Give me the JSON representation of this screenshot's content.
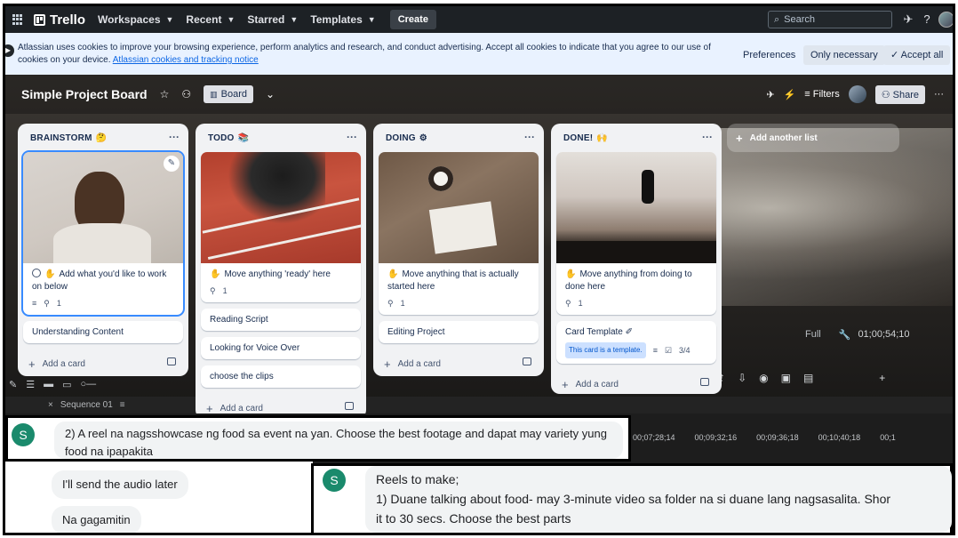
{
  "topnav": {
    "logo": "Trello",
    "menus": [
      "Workspaces",
      "Recent",
      "Starred",
      "Templates"
    ],
    "create_label": "Create",
    "search_placeholder": "Search"
  },
  "cookie": {
    "text": "Atlassian uses cookies to improve your browsing experience, perform analytics and research, and conduct advertising. Accept all cookies to indicate that you agree to our use of cookies on your device.",
    "link": "Atlassian cookies and tracking notice",
    "preferences": "Preferences",
    "only_necessary": "Only necessary",
    "accept_all": "Accept all"
  },
  "board": {
    "title": "Simple Project Board",
    "view_label": "Board",
    "filters_label": "Filters",
    "share_label": "Share",
    "add_list_label": "Add another list"
  },
  "lists": [
    {
      "name": "BRAINSTORM",
      "emoji": "🤔",
      "cover_card": {
        "title": "Add what you'd like to work on below",
        "attachments": "1"
      },
      "cards": [
        "Understanding Content"
      ],
      "add_label": "Add a card"
    },
    {
      "name": "TODO",
      "emoji": "📚",
      "cover_card": {
        "title": "Move anything 'ready' here",
        "attachments": "1"
      },
      "cards": [
        "Reading Script",
        "Looking for Voice Over",
        "choose the clips"
      ],
      "add_label": "Add a card"
    },
    {
      "name": "DOING",
      "emoji": "⚙",
      "cover_card": {
        "title": "Move anything that is actually started here",
        "attachments": "1"
      },
      "cards": [
        "Editing Project"
      ],
      "add_label": "Add a card"
    },
    {
      "name": "DONE!",
      "emoji": "🙌",
      "cover_card": {
        "title": "Move anything from doing to done here",
        "attachments": "1"
      },
      "template_card": {
        "title": "Card Template",
        "badge": "This card is a template.",
        "checklist": "3/4"
      },
      "add_label": "Add a card"
    }
  ],
  "premiere": {
    "zoom": "Full",
    "timecode": "01;00;54;10",
    "sequence": "Sequence 01",
    "ruler": [
      "00;07;28;14",
      "00;09;32;16",
      "00;09;36;18",
      "00;10;40;18",
      "00;1"
    ]
  },
  "chat": {
    "avatar_letter": "S",
    "message1": "2) A reel na nagsshowcase ng food sa event na yan.  Choose the best footage and dapat may variety yung food na ipapakita",
    "message2": "I'll send the audio later",
    "message3": "Na gagamitin",
    "message4_line1": "Reels to make;",
    "message4_line2": "1) Duane talking about food- may 3-minute video sa folder na si duane lang nagsasalita. Shor",
    "message4_line3": "it to 30 secs. Choose the best parts"
  }
}
